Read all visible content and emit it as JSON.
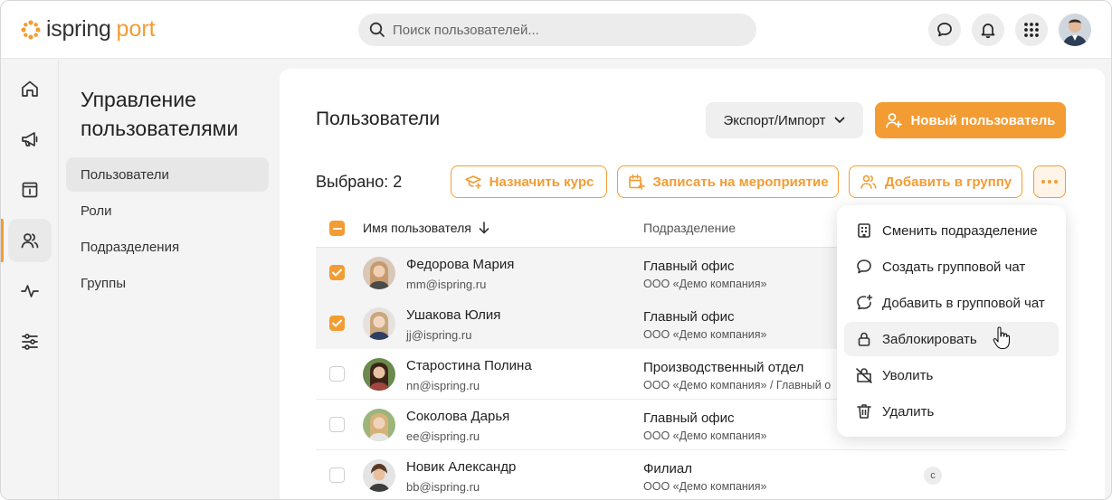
{
  "logo": {
    "part1": "ispring",
    "part2": "port"
  },
  "search": {
    "placeholder": "Поиск пользователей..."
  },
  "colors": {
    "accent": "#f39c33"
  },
  "topbar_icons": [
    "chat-icon",
    "bell-icon",
    "apps-grid-icon",
    "user-avatar"
  ],
  "rail": [
    "home-icon",
    "megaphone-icon",
    "catalog-icon",
    "users-icon",
    "activity-icon",
    "settings-sliders-icon"
  ],
  "subnav": {
    "title": "Управление пользователями",
    "items": [
      {
        "label": "Пользователи",
        "active": true
      },
      {
        "label": "Роли"
      },
      {
        "label": "Подразделения"
      },
      {
        "label": "Группы"
      }
    ]
  },
  "main": {
    "title": "Пользователи",
    "export_label": "Экспорт/Импорт",
    "new_user_label": "Новый пользователь",
    "selected_label": "Выбрано: 2",
    "actions": {
      "assign_course": "Назначить курс",
      "enroll_event": "Записать на мероприятие",
      "add_group": "Добавить в группу",
      "more": "•••"
    },
    "columns": {
      "name": "Имя пользователя",
      "dept": "Подразделение"
    },
    "rows": [
      {
        "name": "Федорова Мария",
        "email": "mm@ispring.ru",
        "dept": "Главный офис",
        "org": "ООО «Демо компания»",
        "checked": true
      },
      {
        "name": "Ушакова Юлия",
        "email": "jj@ispring.ru",
        "dept": "Главный офис",
        "org": "ООО «Демо компания»",
        "checked": true
      },
      {
        "name": "Старостина Полина",
        "email": "nn@ispring.ru",
        "dept": "Производственный отдел",
        "org": "ООО «Демо компания» / Главный о",
        "checked": false
      },
      {
        "name": "Соколова Дарья",
        "email": "ee@ispring.ru",
        "dept": "Главный офис",
        "org": "ООО «Демо компания»",
        "checked": false
      },
      {
        "name": "Новик Александр",
        "email": "bb@ispring.ru",
        "dept": "Филиал",
        "org": "ООО «Демо компания»",
        "checked": false,
        "chip": "с"
      }
    ]
  },
  "menu": {
    "items": [
      {
        "label": "Сменить подразделение",
        "icon": "building-icon"
      },
      {
        "label": "Создать групповой чат",
        "icon": "chat-icon"
      },
      {
        "label": "Добавить в групповой чат",
        "icon": "chat-add-icon"
      },
      {
        "label": "Заблокировать",
        "icon": "lock-icon",
        "hover": true
      },
      {
        "label": "Уволить",
        "icon": "dismiss-icon"
      },
      {
        "label": "Удалить",
        "icon": "trash-icon"
      }
    ]
  }
}
